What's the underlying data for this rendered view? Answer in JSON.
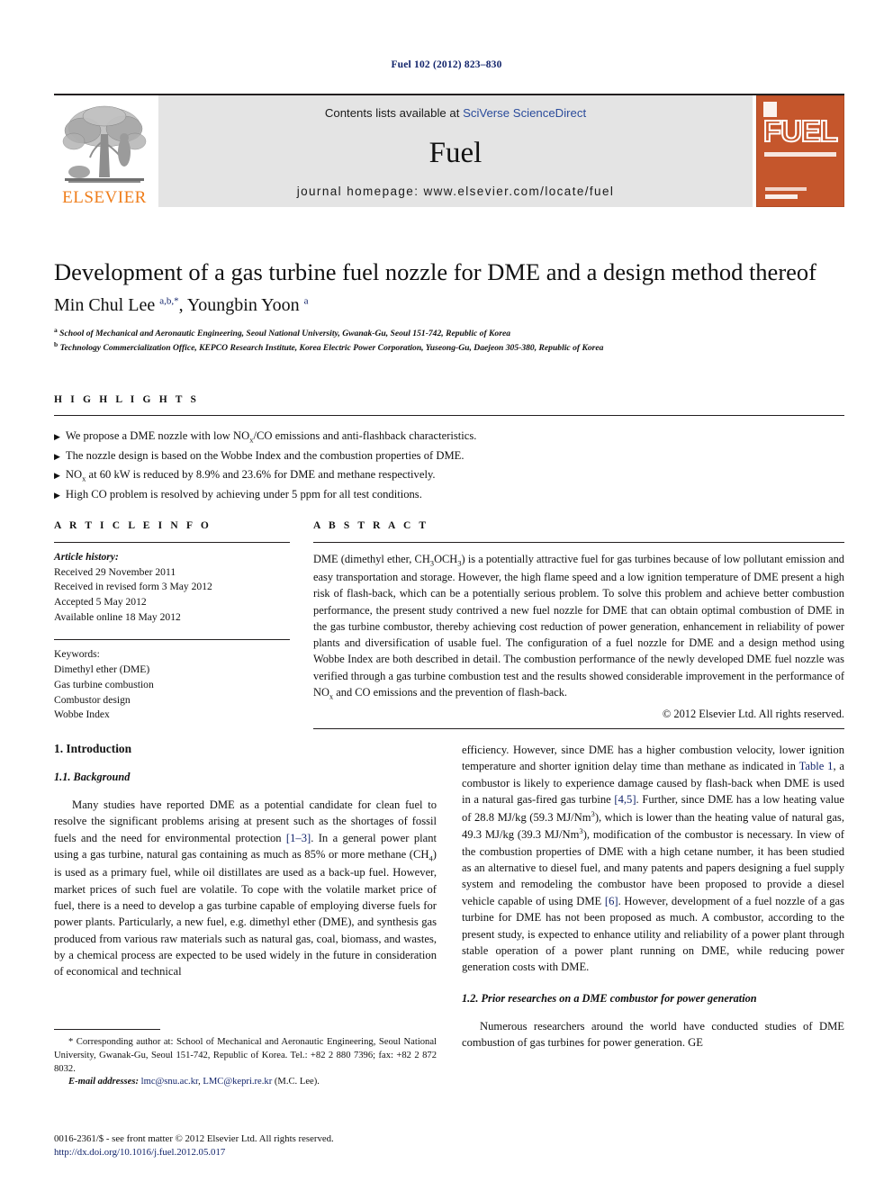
{
  "running_head": "Fuel 102 (2012) 823–830",
  "masthead": {
    "publisher_name": "ELSEVIER",
    "contents_prefix": "Contents lists available at ",
    "contents_link": "SciVerse ScienceDirect",
    "journal_title": "Fuel",
    "homepage": "journal homepage: www.elsevier.com/locate/fuel",
    "cover_word": "FUEL",
    "link_color": "#2a4b9b",
    "cover_color": "#c5562c",
    "banner_bg": "#e4e4e4",
    "elsevier_orange": "#ef7d1a"
  },
  "article": {
    "title": "Development of a gas turbine fuel nozzle for DME and a design method thereof",
    "authors_html": "Min Chul Lee <sup>a,b,*</sup>, Youngbin Yoon <sup>a</sup>",
    "affiliations": [
      "<sup>a</sup> School of Mechanical and Aeronautic Engineering, Seoul National University, Gwanak-Gu, Seoul 151-742, Republic of Korea",
      "<sup>b</sup> Technology Commercialization Office, KEPCO Research Institute, Korea Electric Power Corporation, Yuseong-Gu, Daejeon 305-380, Republic of Korea"
    ]
  },
  "highlights": {
    "heading": "H I G H L I G H T S",
    "bullet_glyph": "▶",
    "items": [
      "We propose a DME nozzle with low NO<sub>x</sub>/CO emissions and anti-flashback characteristics.",
      "The nozzle design is based on the Wobbe Index and the combustion properties of DME.",
      "NO<sub>x</sub> at 60 kW is reduced by 8.9% and 23.6% for DME and methane respectively.",
      "High CO problem is resolved by achieving under 5 ppm for all test conditions."
    ]
  },
  "article_info": {
    "heading": "A R T I C L E   I N F O",
    "history_label": "Article history:",
    "history": [
      "Received 29 November 2011",
      "Received in revised form 3 May 2012",
      "Accepted 5 May 2012",
      "Available online 18 May 2012"
    ],
    "keywords_label": "Keywords:",
    "keywords": [
      "Dimethyl ether (DME)",
      "Gas turbine combustion",
      "Combustor design",
      "Wobbe Index"
    ]
  },
  "abstract": {
    "heading": "A B S T R A C T",
    "text_html": "DME (dimethyl ether, CH<sub>3</sub>OCH<sub>3</sub>) is a potentially attractive fuel for gas turbines because of low pollutant emission and easy transportation and storage. However, the high flame speed and a low ignition temperature of DME present a high risk of flash-back, which can be a potentially serious problem. To solve this problem and achieve better combustion performance, the present study contrived a new fuel nozzle for DME that can obtain optimal combustion of DME in the gas turbine combustor, thereby achieving cost reduction of power generation, enhancement in reliability of power plants and diversification of usable fuel. The configuration of a fuel nozzle for DME and a design method using Wobbe Index are both described in detail. The combustion performance of the newly developed DME fuel nozzle was verified through a gas turbine combustion test and the results showed considerable improvement in the performance of NO<sub>x</sub> and CO emissions and the prevention of flash-back.",
    "copyright": "© 2012 Elsevier Ltd. All rights reserved."
  },
  "body": {
    "section_1": "1. Introduction",
    "subsection_1_1": "1.1. Background",
    "subsection_1_2": "1.2. Prior researches on a DME combustor for power generation",
    "left_paragraphs_html": [
      "Many studies have reported DME as a potential candidate for clean fuel to resolve the significant problems arising at present such as the shortages of fossil fuels and the need for environmental protection <span class=\"ref\">[1–3]</span>. In a general power plant using a gas turbine, natural gas containing as much as 85% or more methane (CH<sub>4</sub>) is used as a primary fuel, while oil distillates are used as a back-up fuel. However, market prices of such fuel are volatile. To cope with the volatile market price of fuel, there is a need to develop a gas turbine capable of employing diverse fuels for power plants. Particularly, a new fuel, e.g. dimethyl ether (DME), and synthesis gas produced from various raw materials such as natural gas, coal, biomass, and wastes, by a chemical process are expected to be used widely in the future in consideration of economical and technical"
    ],
    "right_paragraphs_html": [
      "efficiency. However, since DME has a higher combustion velocity, lower ignition temperature and shorter ignition delay time than methane as indicated in <span class=\"ref\">Table 1</span>, a combustor is likely to experience damage caused by flash-back when DME is used in a natural gas-fired gas turbine <span class=\"ref\">[4,5]</span>. Further, since DME has a low heating value of 28.8 MJ/kg (59.3 MJ/Nm<sup>3</sup>), which is lower than the heating value of natural gas, 49.3 MJ/kg (39.3 MJ/Nm<sup>3</sup>), modification of the combustor is necessary. In view of the combustion properties of DME with a high cetane number, it has been studied as an alternative to diesel fuel, and many patents and papers designing a fuel supply system and remodeling the combustor have been proposed to provide a diesel vehicle capable of using DME <span class=\"ref\">[6]</span>. However, development of a fuel nozzle of a gas turbine for DME has not been proposed as much. A combustor, according to the present study, is expected to enhance utility and reliability of a power plant through stable operation of a power plant running on DME, while reducing power generation costs with DME.",
      "Numerous researchers around the world have conducted studies of DME combustion of gas turbines for power generation. GE"
    ]
  },
  "footnote": {
    "text_html": "* Corresponding author at: School of Mechanical and Aeronautic Engineering, Seoul National University, Gwanak-Gu, Seoul 151-742, Republic of Korea. Tel.: +82 2 880 7396; fax: +82 2 872 8032.",
    "email_html": "<span class=\"ital\">E-mail addresses:</span> <span class=\"fn-email\">lmc@snu.ac.kr</span>, <span class=\"fn-email\">LMC@kepri.re.kr</span> (M.C. Lee)."
  },
  "colophon": {
    "issn_line": "0016-2361/$ - see front matter © 2012 Elsevier Ltd. All rights reserved.",
    "doi": "http://dx.doi.org/10.1016/j.fuel.2012.05.017"
  }
}
